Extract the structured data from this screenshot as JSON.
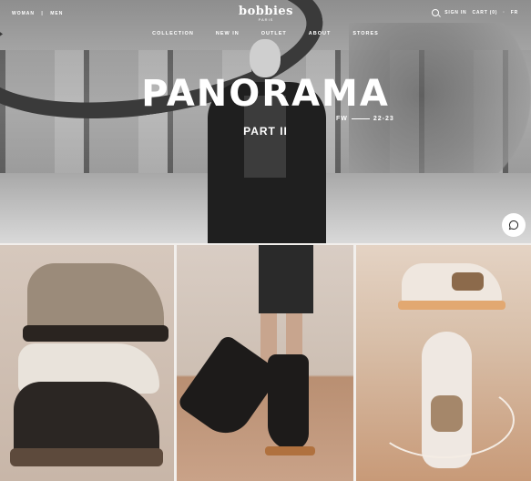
{
  "header": {
    "left_links": [
      "WOMAN",
      "MEN"
    ],
    "logo": "bobbies",
    "logo_sub": "PARIS",
    "right": {
      "signin": "SIGN IN",
      "cart": "CART (0)",
      "language": "FR"
    },
    "nav": [
      "COLLECTION",
      "NEW IN",
      "OUTLET",
      "ABOUT",
      "STORES"
    ]
  },
  "hero": {
    "title": "PANORAMA",
    "season": "FW",
    "season_years": "22-23",
    "subtitle": "PART II"
  },
  "icons": {
    "search": "search-icon",
    "chat": "chat-icon"
  },
  "colors": {
    "overlay_text": "#ffffff",
    "hero_tone": "#8e8e8e"
  }
}
